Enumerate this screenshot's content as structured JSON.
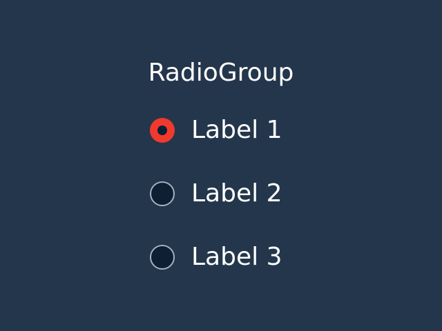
{
  "radio_group": {
    "title": "RadioGroup",
    "selected_index": 0,
    "options": [
      {
        "label": "Label 1",
        "selected": true
      },
      {
        "label": "Label 2",
        "selected": false
      },
      {
        "label": "Label 3",
        "selected": false
      }
    ]
  },
  "colors": {
    "background": "#24364b",
    "selected_accent": "#ef3a2d",
    "unselected_fill": "#0c1f33",
    "unselected_border": "#a4b2c1",
    "text": "#ffffff"
  }
}
